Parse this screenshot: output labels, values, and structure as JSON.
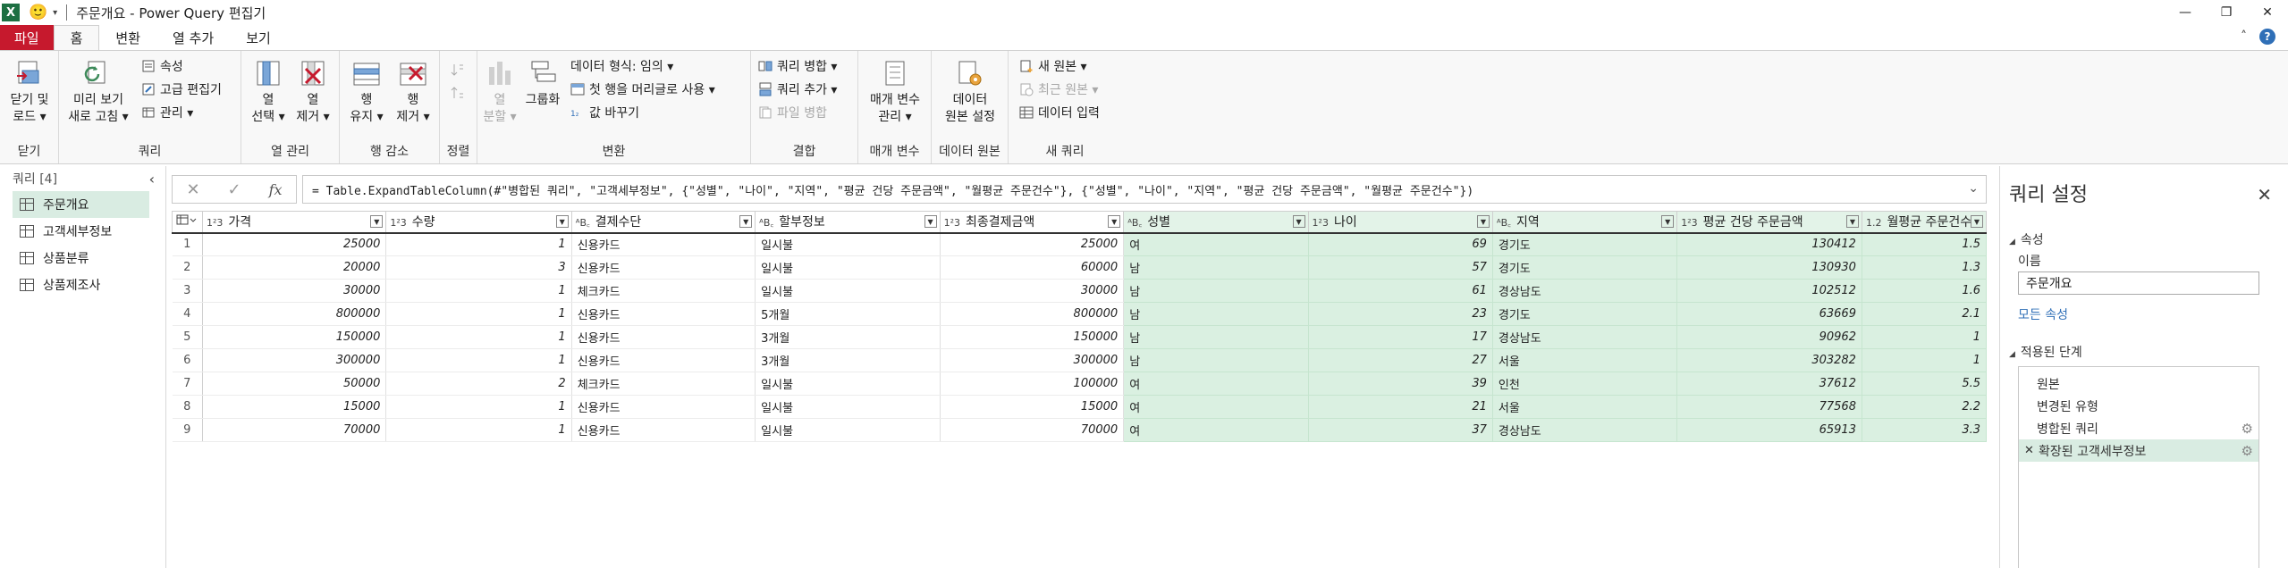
{
  "window": {
    "title": "주문개요 - Power Query 편집기",
    "app_icon": "X",
    "smiley": "🙂",
    "quick_access_arrow": "▾",
    "controls": [
      "—",
      "❐",
      "✕"
    ]
  },
  "menu": {
    "tabs": [
      "파일",
      "홈",
      "변환",
      "열 추가",
      "보기"
    ],
    "active_tab": "홈",
    "right": {
      "collapse": "˄",
      "help": "?"
    }
  },
  "ribbon": {
    "close_group": {
      "label": "닫기",
      "btn_line1": "닫기 및",
      "btn_line2": "로드 ▾"
    },
    "query_group": {
      "label": "쿼리",
      "refresh_line1": "미리 보기",
      "refresh_line2": "새로 고침 ▾",
      "properties": "속성",
      "advanced_editor": "고급 편집기",
      "manage": "관리 ▾"
    },
    "columns_group": {
      "label": "열 관리",
      "select_line1": "열",
      "select_line2": "선택 ▾",
      "remove_line1": "열",
      "remove_line2": "제거 ▾"
    },
    "rows_group": {
      "label": "행 감소",
      "keep_line1": "행",
      "keep_line2": "유지 ▾",
      "remove_line1": "행",
      "remove_line2": "제거 ▾"
    },
    "sort_group": {
      "label": "정렬"
    },
    "transform_group": {
      "label": "변환",
      "split_line1": "열",
      "split_line2": "분할 ▾",
      "group_by": "그룹화",
      "data_type": "데이터 형식: 임의 ▾",
      "first_row_header": "첫 행을 머리글로 사용 ▾",
      "replace_values": "값 바꾸기"
    },
    "combine_group": {
      "label": "결합",
      "merge_queries": "쿼리 병합 ▾",
      "append_queries": "쿼리 추가 ▾",
      "combine_files": "파일 병합"
    },
    "params_group": {
      "label": "매개 변수",
      "line1": "매개 변수",
      "line2": "관리 ▾"
    },
    "datasource_group": {
      "label": "데이터 원본",
      "line1": "데이터",
      "line2": "원본 설정"
    },
    "newquery_group": {
      "label": "새 쿼리",
      "new_source": "새 원본 ▾",
      "recent_sources": "최근 원본 ▾",
      "enter_data": "데이터 입력"
    }
  },
  "query_pane": {
    "header": "쿼리 [4]",
    "collapse": "‹",
    "items": [
      "주문개요",
      "고객세부정보",
      "상품분류",
      "상품제조사"
    ],
    "selected": "주문개요"
  },
  "formula_bar": {
    "cancel": "✕",
    "commit": "✓",
    "fx": "fx",
    "formula": "= Table.ExpandTableColumn(#\"병합된 쿼리\", \"고객세부정보\", {\"성별\", \"나이\", \"지역\", \"평균 건당 주문금액\", \"월평균 주문건수\"}, {\"성별\", \"나이\", \"지역\", \"평균 건당 주문금액\", \"월평균 주문건수\"})",
    "expand": "⌄"
  },
  "grid": {
    "columns": [
      {
        "type": "1²3",
        "name": "가격",
        "green": false
      },
      {
        "type": "1²3",
        "name": "수량",
        "green": false
      },
      {
        "type": "ᴬB꜀",
        "name": "결제수단",
        "green": false
      },
      {
        "type": "ᴬB꜀",
        "name": "할부정보",
        "green": false
      },
      {
        "type": "1²3",
        "name": "최종결제금액",
        "green": false
      },
      {
        "type": "ᴬB꜀",
        "name": "성별",
        "green": true
      },
      {
        "type": "1²3",
        "name": "나이",
        "green": true
      },
      {
        "type": "ᴬB꜀",
        "name": "지역",
        "green": true
      },
      {
        "type": "1²3",
        "name": "평균 건당 주문금액",
        "green": true
      },
      {
        "type": "1.2",
        "name": "월평균 주문건수",
        "green": true
      }
    ],
    "rows": [
      [
        "1",
        "25000",
        "1",
        "신용카드",
        "일시불",
        "25000",
        "여",
        "69",
        "경기도",
        "130412",
        "1.5"
      ],
      [
        "2",
        "20000",
        "3",
        "신용카드",
        "일시불",
        "60000",
        "남",
        "57",
        "경기도",
        "130930",
        "1.3"
      ],
      [
        "3",
        "30000",
        "1",
        "체크카드",
        "일시불",
        "30000",
        "남",
        "61",
        "경상남도",
        "102512",
        "1.6"
      ],
      [
        "4",
        "800000",
        "1",
        "신용카드",
        "5개월",
        "800000",
        "남",
        "23",
        "경기도",
        "63669",
        "2.1"
      ],
      [
        "5",
        "150000",
        "1",
        "신용카드",
        "3개월",
        "150000",
        "남",
        "17",
        "경상남도",
        "90962",
        "1"
      ],
      [
        "6",
        "300000",
        "1",
        "신용카드",
        "3개월",
        "300000",
        "남",
        "27",
        "서울",
        "303282",
        "1"
      ],
      [
        "7",
        "50000",
        "2",
        "체크카드",
        "일시불",
        "100000",
        "여",
        "39",
        "인천",
        "37612",
        "5.5"
      ],
      [
        "8",
        "15000",
        "1",
        "신용카드",
        "일시불",
        "15000",
        "여",
        "21",
        "서울",
        "77568",
        "2.2"
      ],
      [
        "9",
        "70000",
        "1",
        "신용카드",
        "일시불",
        "70000",
        "여",
        "37",
        "경상남도",
        "65913",
        "3.3"
      ]
    ]
  },
  "settings": {
    "title": "쿼리 설정",
    "close": "✕",
    "properties_header": "속성",
    "name_label": "이름",
    "name_value": "주문개요",
    "all_properties": "모든 속성",
    "steps_header": "적용된 단계",
    "steps": [
      {
        "label": "원본",
        "gear": false,
        "selected": false
      },
      {
        "label": "변경된 유형",
        "gear": false,
        "selected": false
      },
      {
        "label": "병합된 쿼리",
        "gear": true,
        "selected": false
      },
      {
        "label": "확장된 고객세부정보",
        "gear": true,
        "selected": true
      }
    ]
  },
  "colors": {
    "accent_file_tab": "#c6192d",
    "green_cols": "#daf0e1",
    "link": "#2f6fb7",
    "selection": "#d9ece2"
  }
}
